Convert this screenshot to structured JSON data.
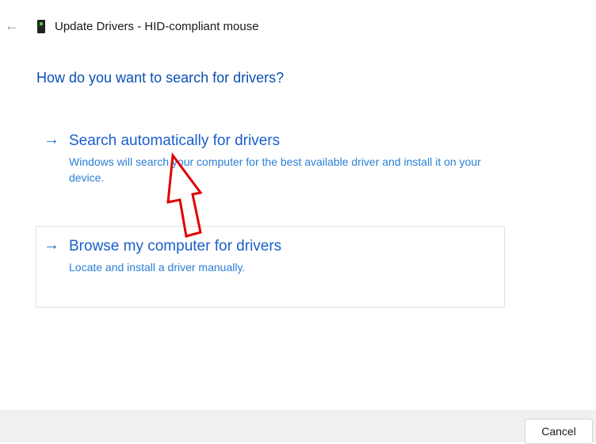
{
  "window": {
    "title": "Update Drivers - HID-compliant mouse",
    "back_icon": "back-arrow-icon",
    "device_icon": "device-icon"
  },
  "main": {
    "heading": "How do you want to search for drivers?",
    "options": [
      {
        "title": "Search automatically for drivers",
        "description": "Windows will search your computer for the best available driver and install it on your device."
      },
      {
        "title": "Browse my computer for drivers",
        "description": "Locate and install a driver manually."
      }
    ],
    "arrow_glyph": "→"
  },
  "footer": {
    "cancel_label": "Cancel"
  },
  "annotation": {
    "color": "#e00000"
  }
}
